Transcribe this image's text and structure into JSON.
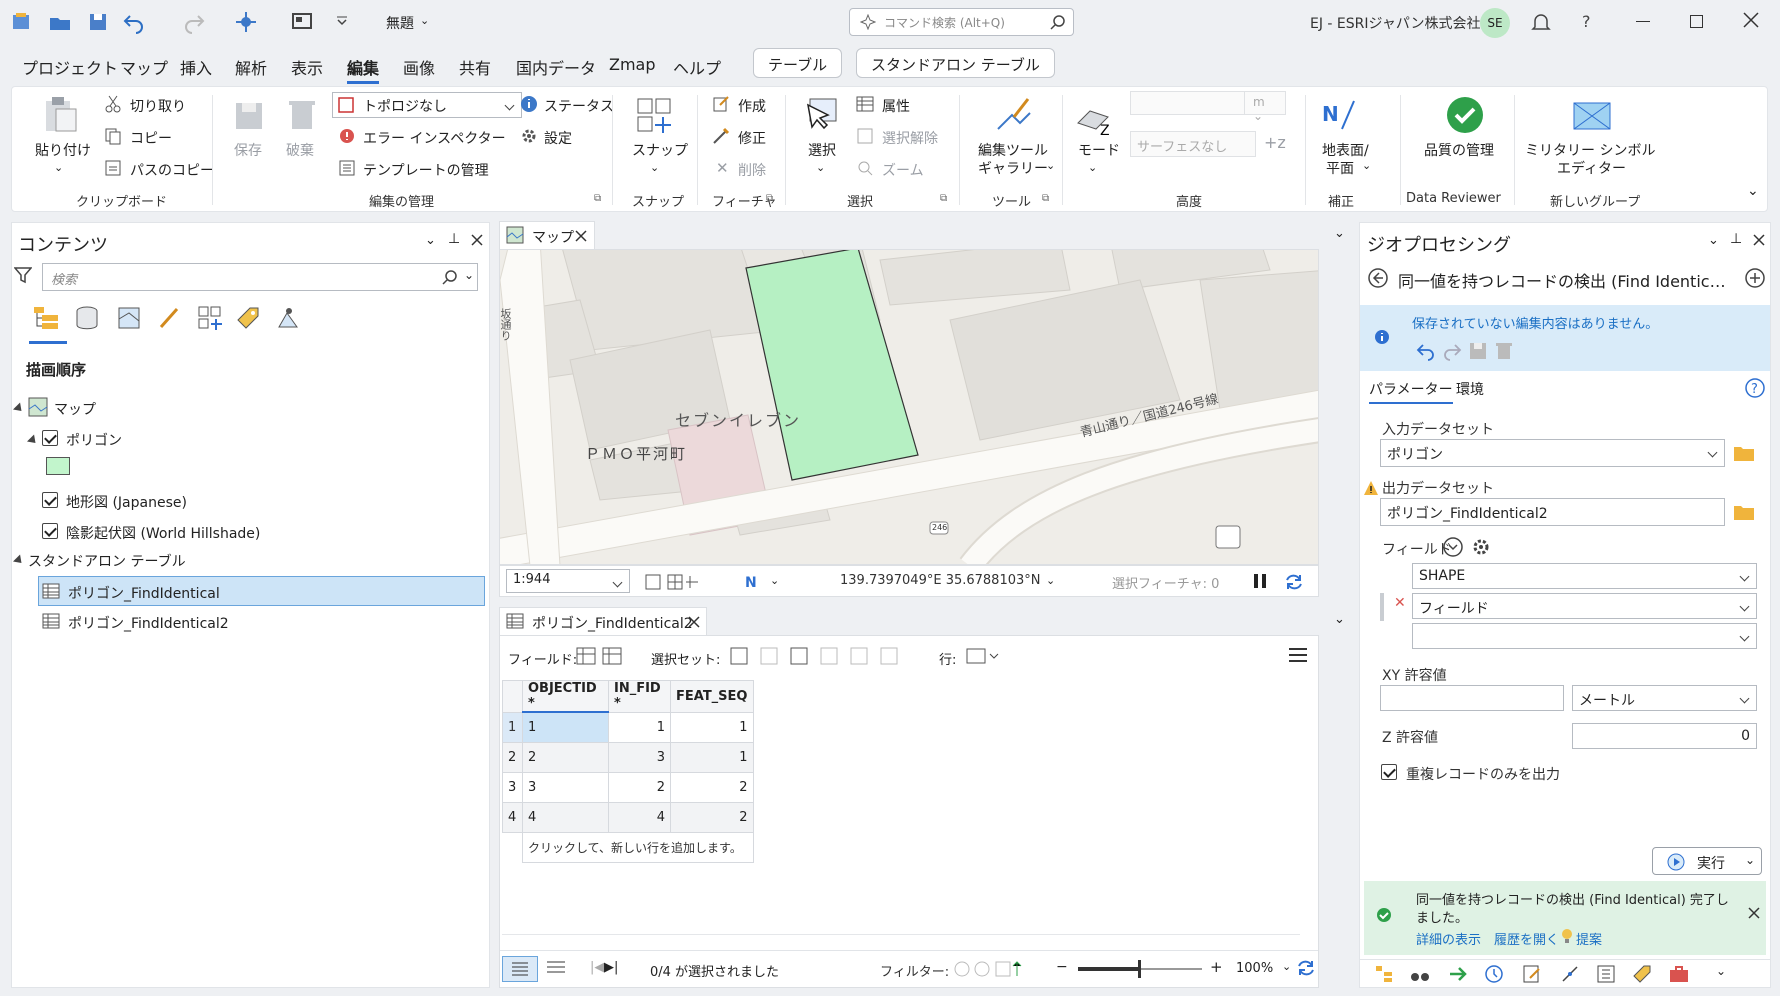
{
  "titlebar": {
    "project": "無題",
    "search_placeholder": "コマンド検索 (Alt+Q)",
    "account": "EJ - ESRIジャパン株式会社",
    "initials": "SE",
    "help": "?"
  },
  "menu": [
    "プロジェクト",
    "マップ",
    "挿入",
    "解析",
    "表示",
    "編集",
    "画像",
    "共有",
    "国内データ",
    "Zmap",
    "ヘルプ"
  ],
  "context_tabs": [
    "テーブル",
    "スタンドアロン テーブル"
  ],
  "ribbon": {
    "clipboard": {
      "paste": "貼り付け",
      "cut": "切り取り",
      "copy": "コピー",
      "copy_path": "パスのコピー",
      "label": "クリップボード"
    },
    "manage": {
      "save": "保存",
      "discard": "破棄",
      "topology": "トポロジなし",
      "error_inspector": "エラー インスペクター",
      "template_mgr": "テンプレートの管理",
      "status": "ステータス",
      "settings": "設定",
      "label": "編集の管理"
    },
    "snap": {
      "snap": "スナップ",
      "label": "スナップ"
    },
    "features": {
      "create": "作成",
      "modify": "修正",
      "delete": "削除",
      "label": "フィーチャ"
    },
    "selection": {
      "select": "選択",
      "attributes": "属性",
      "clear": "選択解除",
      "zoom": "ズーム",
      "label": "選択"
    },
    "tools": {
      "gallery_1": "編集ツール",
      "gallery_2": "ギャラリー",
      "label": "ツール"
    },
    "elevation": {
      "mode": "モード",
      "unit": "m",
      "surface": "サーフェスなし",
      "label": "高度"
    },
    "correction": {
      "btn_1": "地表面/",
      "btn_2": "平面",
      "label": "補正"
    },
    "reviewer": {
      "btn": "品質の管理",
      "label": "Data Reviewer"
    },
    "newgroup": {
      "btn_1": "ミリタリー シンボル",
      "btn_2": "エディター",
      "label": "新しいグループ"
    }
  },
  "contents": {
    "title": "コンテンツ",
    "search_placeholder": "検索",
    "section": "描画順序",
    "map": "マップ",
    "polygon": "ポリゴン",
    "polygon_color": "#c2f5cc",
    "topo": "地形図 (Japanese)",
    "hillshade": "陰影起伏図 (World Hillshade)",
    "standalone": "スタンドアロン テーブル",
    "table1": "ポリゴン_FindIdentical",
    "table2": "ポリゴン_FindIdentical2"
  },
  "map": {
    "tab": "マップ",
    "labels": {
      "seven": "セブンイレブン",
      "pmo": "ＰＭＯ平河町",
      "aoyama": "青山通り／国道246号線",
      "road": "246",
      "side": "坂通り"
    },
    "scale": "1:944",
    "coords": "139.7397049°E 35.6788103°N",
    "selected": "選択フィーチャ: 0"
  },
  "table": {
    "tab": "ポリゴン_FindIdentical2",
    "field_label": "フィールド:",
    "selset_label": "選択セット:",
    "row_label": "行:",
    "columns": [
      "OBJECTID *",
      "IN_FID *",
      "FEAT_SEQ"
    ],
    "rows": [
      {
        "n": "1",
        "oid": "1",
        "fid": "1",
        "seq": "1"
      },
      {
        "n": "2",
        "oid": "2",
        "fid": "3",
        "seq": "1"
      },
      {
        "n": "3",
        "oid": "3",
        "fid": "2",
        "seq": "2"
      },
      {
        "n": "4",
        "oid": "4",
        "fid": "4",
        "seq": "2"
      }
    ],
    "add_row": "クリックして、新しい行を追加します。",
    "status": "0/4 が選択されました",
    "filter": "フィルター:",
    "zoom": "100%"
  },
  "gp": {
    "title": "ジオプロセシング",
    "tool": "同一値を持つレコードの検出 (Find Identic…",
    "info": "保存されていない編集内容はありません。",
    "tab_params": "パラメーター",
    "tab_env": "環境",
    "input_label": "入力データセット",
    "input_value": "ポリゴン",
    "output_label": "出力データセット",
    "output_value": "ポリゴン_FindIdentical2",
    "field_label": "フィールド",
    "field1": "SHAPE",
    "field2": "フィールド",
    "xy_label": "XY 許容値",
    "xy_unit": "メートル",
    "z_label": "Z 許容値",
    "z_value": "0",
    "only_dup": "重複レコードのみを出力",
    "run": "実行",
    "done_1": "同一値を持つレコードの検出 (Find Identical) 完了し",
    "done_2": "ました。",
    "details": "詳細の表示",
    "history": "履歴を開く",
    "suggest": "提案"
  }
}
